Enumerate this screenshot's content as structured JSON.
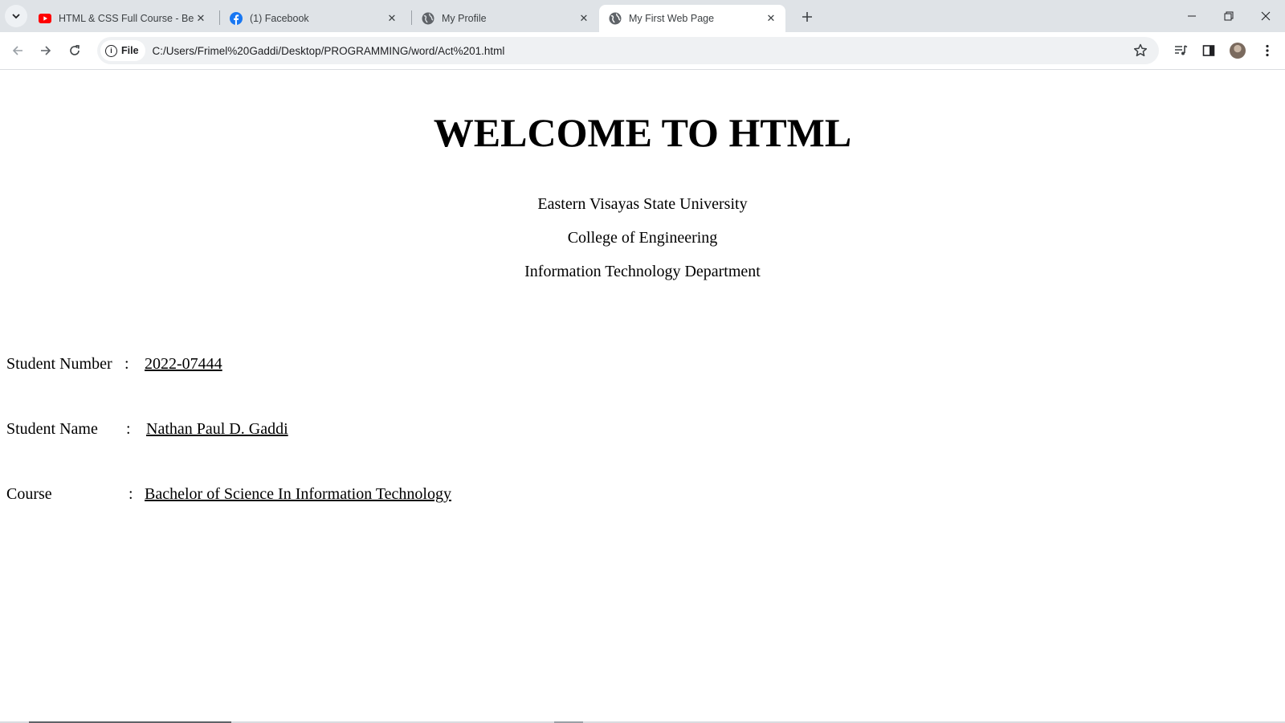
{
  "tabs": [
    {
      "title": "HTML & CSS Full Course - Begi",
      "icon": "youtube-icon",
      "active": false
    },
    {
      "title": "(1) Facebook",
      "icon": "facebook-icon",
      "active": false
    },
    {
      "title": "My Profile",
      "icon": "globe-icon",
      "active": false
    },
    {
      "title": "My First Web Page",
      "icon": "globe-icon",
      "active": true
    }
  ],
  "toolbar": {
    "chip_label": "File",
    "url": "C:/Users/Frimel%20Gaddi/Desktop/PROGRAMMING/word/Act%201.html"
  },
  "page": {
    "heading": "WELCOME TO HTML",
    "university": "Eastern Visayas State University",
    "college": "College of Engineering",
    "department": "Information Technology Department",
    "fields": [
      {
        "label": "Student Number",
        "separator": ":",
        "value": "2022-07444"
      },
      {
        "label": "Student Name",
        "separator": ":",
        "value": "Nathan Paul D. Gaddi"
      },
      {
        "label": "Course",
        "separator": ":",
        "value": "Bachelor of Science In Information Technology"
      }
    ]
  },
  "colors": {
    "tabstrip_bg": "#dfe3e7",
    "omnibox_bg": "#eff1f3",
    "youtube_red": "#ff0000",
    "facebook_blue": "#1877f2"
  }
}
